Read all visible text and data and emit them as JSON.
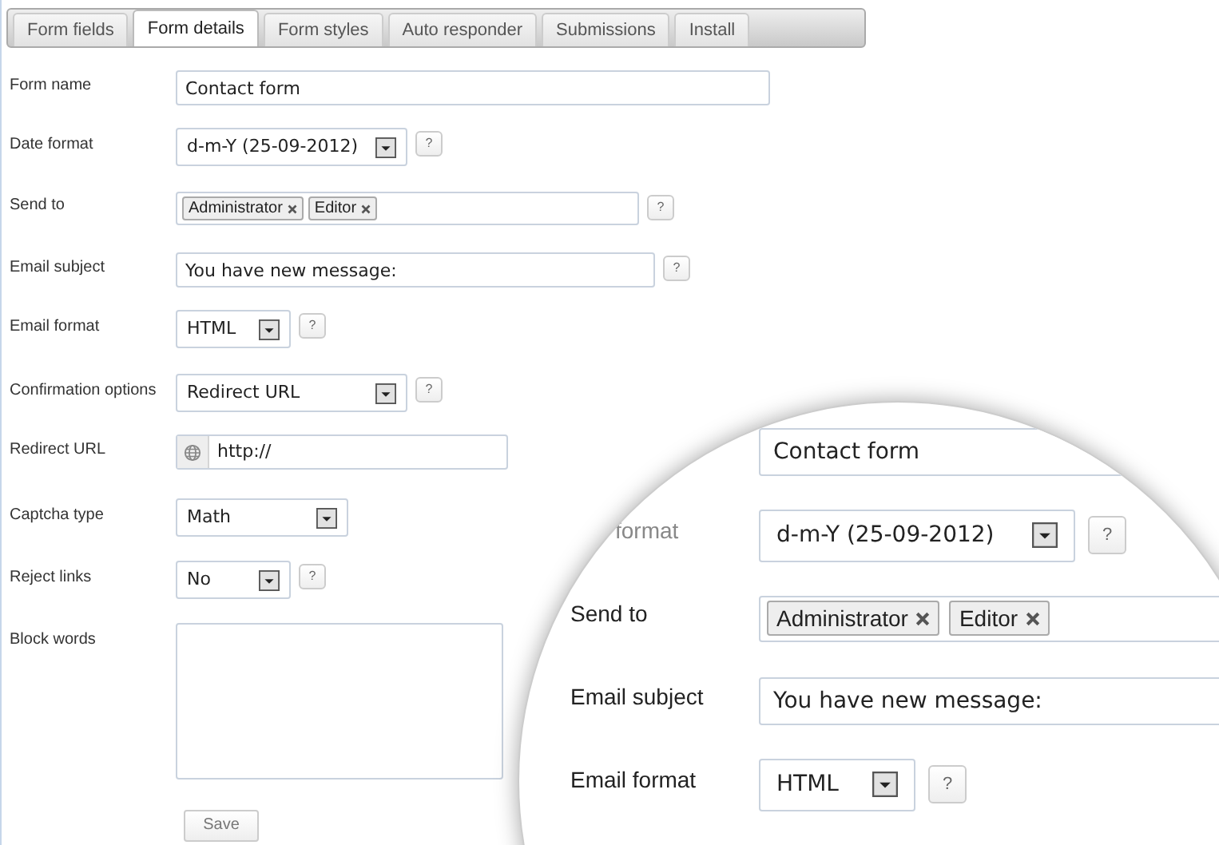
{
  "tabs": [
    {
      "label": "Form fields",
      "selected": false
    },
    {
      "label": "Form details",
      "selected": true
    },
    {
      "label": "Form styles",
      "selected": false
    },
    {
      "label": "Auto responder",
      "selected": false
    },
    {
      "label": "Submissions",
      "selected": false
    },
    {
      "label": "Install",
      "selected": false
    }
  ],
  "fields": [
    {
      "label": "Form name",
      "kind": "text",
      "value": "Contact form"
    },
    {
      "label": "Date format",
      "kind": "select",
      "value": "d-m-Y (25-09-2012)",
      "help": "?"
    },
    {
      "label": "Send to",
      "kind": "tags",
      "tags": [
        "Administrator",
        "Editor"
      ],
      "help": "?"
    },
    {
      "label": "Email subject",
      "kind": "text",
      "value": "You have new message:",
      "help": "?"
    },
    {
      "label": "Email format",
      "kind": "select",
      "value": "HTML",
      "help": "?"
    },
    {
      "label": "Confirmation options",
      "kind": "select",
      "value": "Redirect URL",
      "help": "?"
    },
    {
      "label": "Redirect URL",
      "kind": "url",
      "value": "http://"
    },
    {
      "label": "Captcha type",
      "kind": "select",
      "value": "Math"
    },
    {
      "label": "Reject links",
      "kind": "select",
      "value": "No",
      "help": "?"
    },
    {
      "label": "Block words",
      "kind": "textarea"
    }
  ],
  "save_button": "Save",
  "magnifier": [
    {
      "kind": "text",
      "value": "Contact form"
    },
    {
      "label": "format",
      "kind": "select",
      "value": "d-m-Y (25-09-2012)",
      "help": "?"
    },
    {
      "label": "Send to",
      "kind": "tags",
      "tags": [
        "Administrator",
        "Editor"
      ]
    },
    {
      "label": "Email subject",
      "kind": "text",
      "value": "You have new message:"
    },
    {
      "label": "Email format",
      "kind": "select",
      "value": "HTML",
      "help": "?"
    }
  ]
}
